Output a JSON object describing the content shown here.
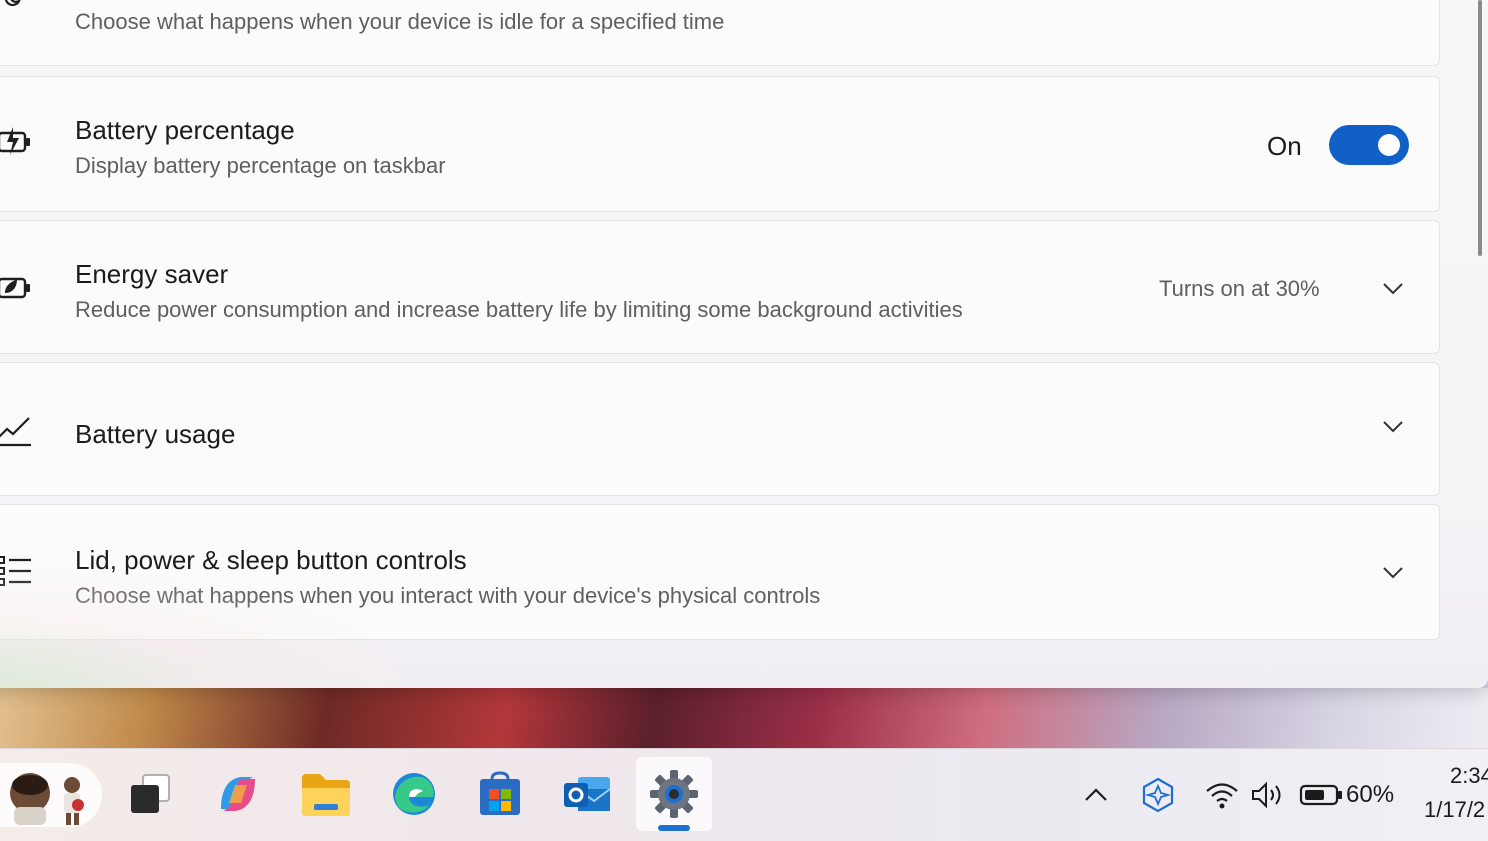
{
  "settings": {
    "sleep_card": {
      "description": "Choose what happens when your device is idle for a specified time"
    },
    "battery_percentage": {
      "title": "Battery percentage",
      "description": "Display battery percentage on taskbar",
      "toggle_label": "On",
      "toggle_state": true
    },
    "energy_saver": {
      "title": "Energy saver",
      "description": "Reduce power consumption and increase battery life by limiting some background activities",
      "value": "Turns on at 30%"
    },
    "battery_usage": {
      "title": "Battery usage"
    },
    "lid_power": {
      "title": "Lid, power & sleep button controls",
      "description": "Choose what happens when you interact with your device's physical controls"
    }
  },
  "taskbar": {
    "apps": [
      {
        "name": "Task View",
        "icon": "task-view-icon"
      },
      {
        "name": "Copilot",
        "icon": "copilot-icon"
      },
      {
        "name": "File Explorer",
        "icon": "file-explorer-icon"
      },
      {
        "name": "Microsoft Edge",
        "icon": "edge-icon"
      },
      {
        "name": "Microsoft Store",
        "icon": "store-icon"
      },
      {
        "name": "Outlook",
        "icon": "outlook-icon"
      },
      {
        "name": "Settings",
        "icon": "settings-gear-icon",
        "active": true
      }
    ],
    "tray": {
      "battery_percent": "60%",
      "time": "2:34",
      "date": "1/17/2"
    }
  },
  "colors": {
    "accent": "#1060c8",
    "card_background": "#fbfbfc",
    "secondary_text": "#5f5f5f"
  }
}
